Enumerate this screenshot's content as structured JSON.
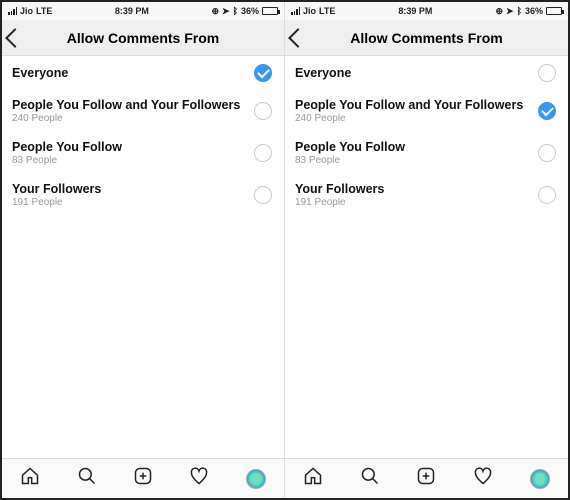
{
  "status": {
    "carrier": "Jio",
    "network": "LTE",
    "time": "8:39 PM",
    "battery_pct": "36%"
  },
  "header": {
    "title": "Allow Comments From"
  },
  "options": [
    {
      "label": "Everyone",
      "sub": ""
    },
    {
      "label": "People You Follow and Your Followers",
      "sub": "240 People"
    },
    {
      "label": "People You Follow",
      "sub": "83 People"
    },
    {
      "label": "Your Followers",
      "sub": "191 People"
    }
  ],
  "panes": [
    {
      "selected_index": 0
    },
    {
      "selected_index": 1
    }
  ]
}
